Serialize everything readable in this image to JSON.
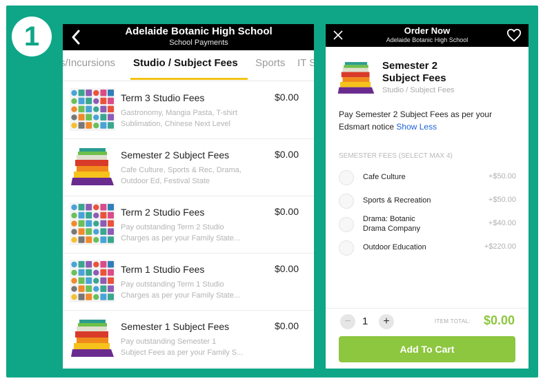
{
  "step_number": "1",
  "left": {
    "header": {
      "back_icon": "chevron-left-icon",
      "title": "Adelaide Botanic High School",
      "subtitle": "School Payments"
    },
    "tabs": [
      {
        "label": "s/Incursions"
      },
      {
        "label": "Studio / Subject Fees",
        "active": true
      },
      {
        "label": "Sports"
      },
      {
        "label": "IT S"
      }
    ],
    "items": [
      {
        "name": "Term 3 Studio Fees",
        "price": "$0.00",
        "desc1": "Gastronomy, Mangia Pasta, T-shirt",
        "desc2": "Sublimation, Chinese Next Level",
        "thumb": "collage"
      },
      {
        "name": "Semester 2 Subject Fees",
        "price": "$0.00",
        "desc1": "Cafe Culture, Sports & Rec, Drama,",
        "desc2": "Outdoor Ed, Festival State",
        "thumb": "books"
      },
      {
        "name": "Term 2 Studio Fees",
        "price": "$0.00",
        "desc1": "Pay outstanding Term 2 Studio",
        "desc2": "Charges as per your Family State...",
        "thumb": "collage"
      },
      {
        "name": "Term 1 Studio Fees",
        "price": "$0.00",
        "desc1": "Pay outstanding Term 1 Studio",
        "desc2": "Charges as per your Family State...",
        "thumb": "collage"
      },
      {
        "name": "Semester 1 Subject Fees",
        "price": "$0.00",
        "desc1": "Pay outstanding Semester 1",
        "desc2": "Subject Fees as per your Family S...",
        "thumb": "books"
      }
    ]
  },
  "right": {
    "header": {
      "close_icon": "close-icon",
      "title": "Order Now",
      "subtitle": "Adelaide Botanic High School",
      "favorite_icon": "heart-icon"
    },
    "product": {
      "name_line1": "Semester 2",
      "name_line2": "Subject Fees",
      "category": "Studio / Subject Fees",
      "description": "Pay Semester 2 Subject Fees as per your Edsmart notice",
      "show_less": "Show Less"
    },
    "section_label": "SEMESTER FEES (SELECT MAX 4)",
    "options": [
      {
        "line1": "Cafe Culture",
        "line2": "",
        "price": "+$50.00"
      },
      {
        "line1": "Sports & Recreation",
        "line2": "",
        "price": "+$50.00"
      },
      {
        "line1": "Drama: Botanic",
        "line2": "Drama Company",
        "price": "+$40.00"
      },
      {
        "line1": "Outdoor Education",
        "line2": "",
        "price": "+$220.00"
      }
    ],
    "footer": {
      "qty_minus": "−",
      "quantity": "1",
      "qty_plus": "+",
      "item_total_label": "ITEM TOTAL:",
      "item_total_value": "$0.00",
      "add_to_cart": "Add To Cart"
    }
  },
  "colors": {
    "frame": "#0ea687",
    "accent_green": "#8dc63f",
    "tab_underline": "#f2c318",
    "link_blue": "#1c62d8"
  }
}
